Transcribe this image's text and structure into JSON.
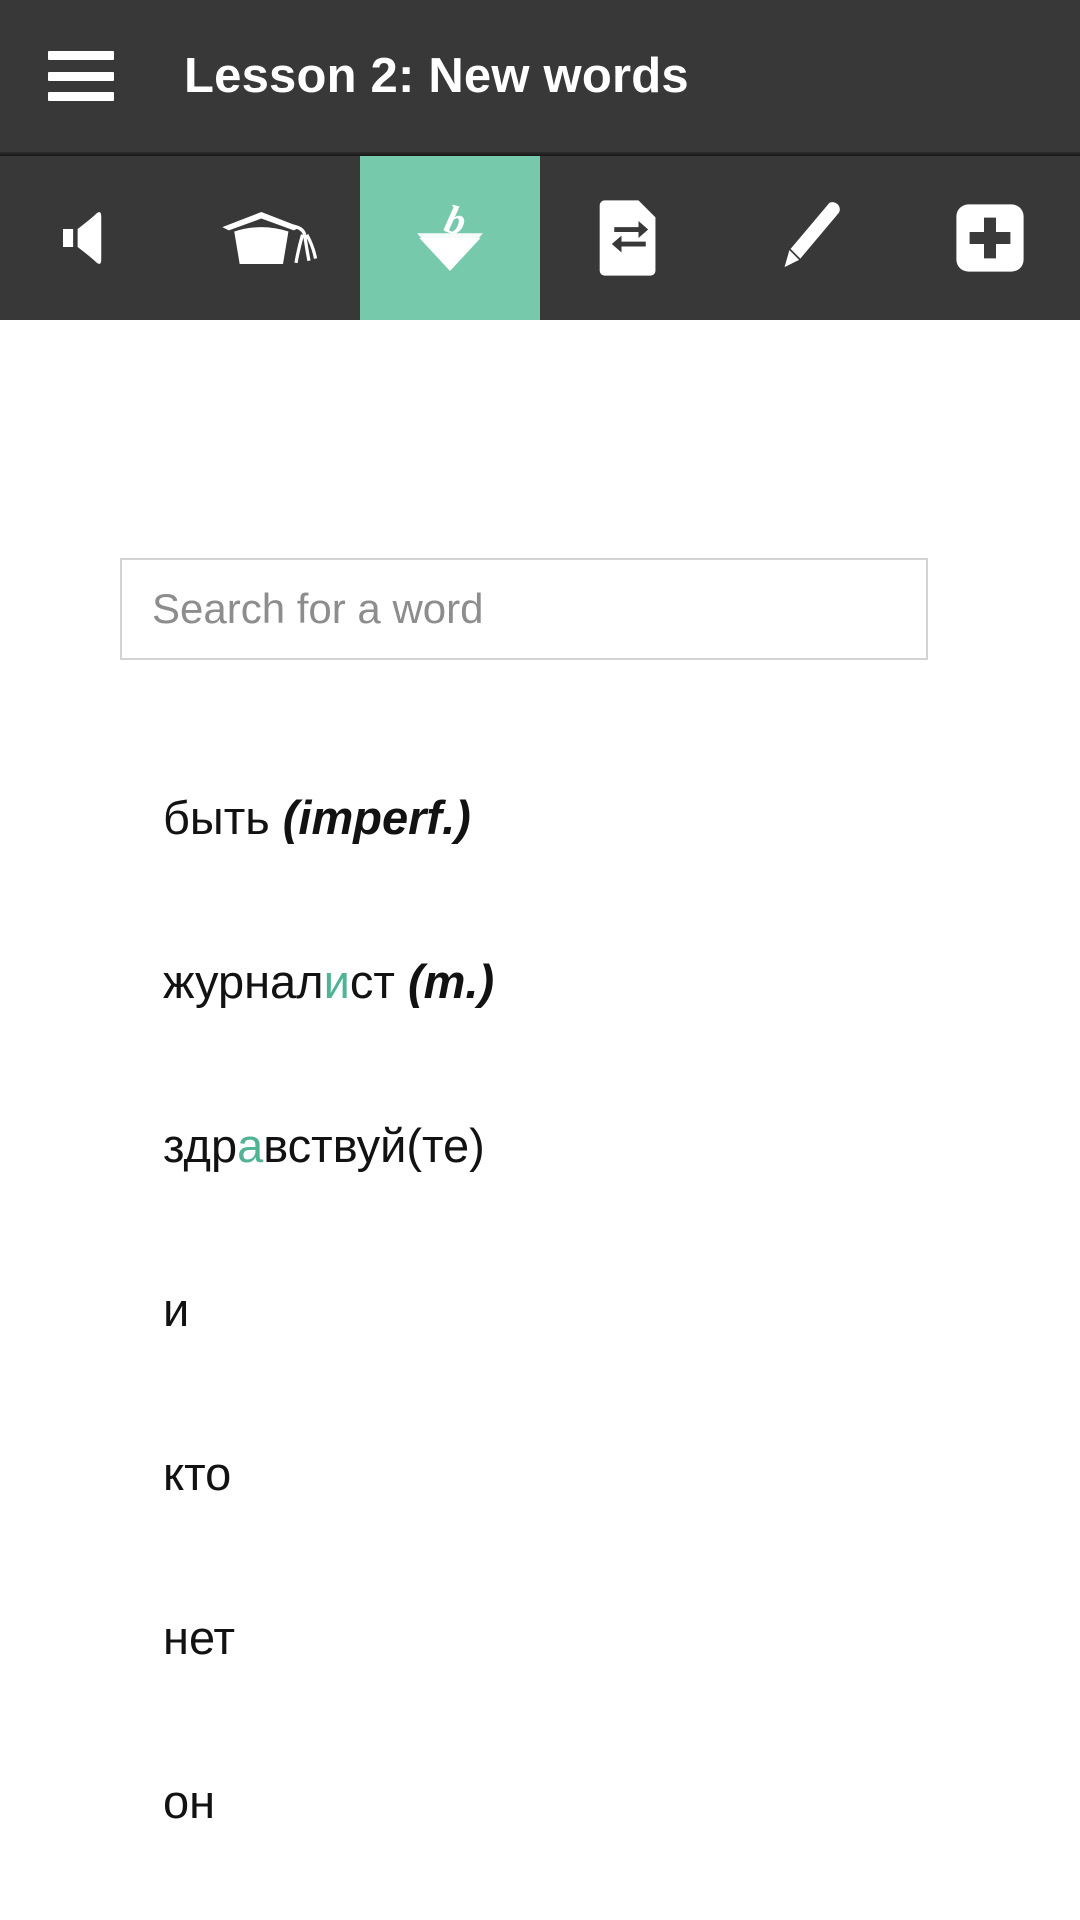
{
  "header": {
    "menu_icon": "hamburger-menu-icon",
    "title": "Lesson 2: New words"
  },
  "colors": {
    "header_background": "#383838",
    "toolbar_background": "#383838",
    "accent_teal": "#77c9ac",
    "stress_teal": "#4fb394",
    "text_primary": "#121212",
    "placeholder": "#8d8d8d",
    "input_border": "#d3d3d3",
    "page_background": "#ffffff"
  },
  "toolbar": {
    "tabs": [
      {
        "id": "pronunciation",
        "icon": "speaker-icon",
        "active": false
      },
      {
        "id": "grammar",
        "icon": "graduation-cap-icon",
        "active": false
      },
      {
        "id": "vocabulary",
        "icon": "word-box-icon",
        "active": true
      },
      {
        "id": "translation",
        "icon": "document-exchange-icon",
        "active": false
      },
      {
        "id": "exercises",
        "icon": "pencil-icon",
        "active": false
      },
      {
        "id": "add",
        "icon": "plus-square-icon",
        "active": false
      }
    ]
  },
  "search": {
    "placeholder": "Search for a word",
    "value": ""
  },
  "word_list": {
    "items": [
      {
        "id": "byt",
        "parts": [
          {
            "text": "быть",
            "style": "plain"
          },
          {
            "text": " ",
            "style": "plain"
          },
          {
            "text": "(imperf.)",
            "style": "gram"
          }
        ],
        "plain": "быть (imperf.)"
      },
      {
        "id": "zhurnalist",
        "parts": [
          {
            "text": "журнал",
            "style": "plain"
          },
          {
            "text": "и",
            "style": "stress"
          },
          {
            "text": "ст",
            "style": "plain"
          },
          {
            "text": " ",
            "style": "plain"
          },
          {
            "text": "(m.)",
            "style": "gram"
          }
        ],
        "plain": "журналист (m.)"
      },
      {
        "id": "zdravstvuyte",
        "parts": [
          {
            "text": "здр",
            "style": "plain"
          },
          {
            "text": "а",
            "style": "stress"
          },
          {
            "text": "вствуй(те)",
            "style": "plain"
          }
        ],
        "plain": "здравствуй(те)"
      },
      {
        "id": "i",
        "parts": [
          {
            "text": "и",
            "style": "plain"
          }
        ],
        "plain": "и"
      },
      {
        "id": "kto",
        "parts": [
          {
            "text": "кто",
            "style": "plain"
          }
        ],
        "plain": "кто"
      },
      {
        "id": "net",
        "parts": [
          {
            "text": "нет",
            "style": "plain"
          }
        ],
        "plain": "нет"
      },
      {
        "id": "on",
        "parts": [
          {
            "text": "он",
            "style": "plain"
          }
        ],
        "plain": "он"
      }
    ]
  }
}
